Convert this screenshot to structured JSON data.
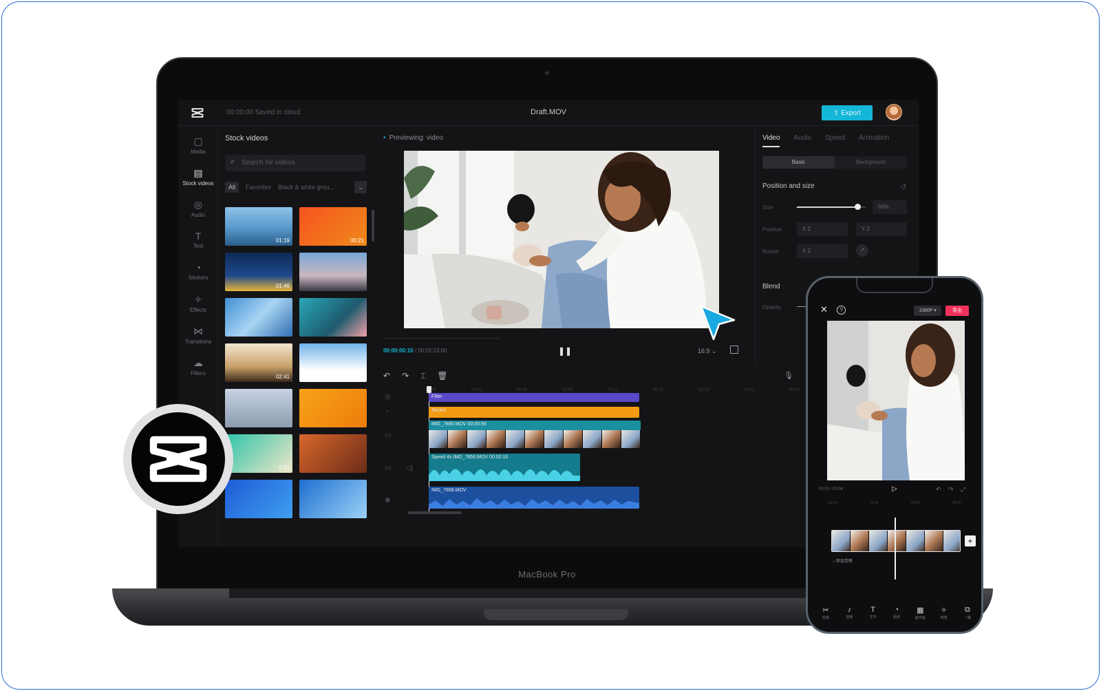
{
  "app": {
    "saved_status": "00:00:00 Saved in cloud",
    "doc_title": "Draft.MOV",
    "export_label": "Export"
  },
  "rail": [
    {
      "label": "Media",
      "icon": "media-icon"
    },
    {
      "label": "Stock videos",
      "icon": "stock-videos-icon",
      "active": true
    },
    {
      "label": "Audio",
      "icon": "audio-icon"
    },
    {
      "label": "Text",
      "icon": "text-icon"
    },
    {
      "label": "Stickers",
      "icon": "stickers-icon"
    },
    {
      "label": "Effects",
      "icon": "effects-icon"
    },
    {
      "label": "Transitions",
      "icon": "transitions-icon"
    },
    {
      "label": "Filters",
      "icon": "filters-icon"
    }
  ],
  "stock": {
    "title": "Stock videos",
    "search_placeholder": "Search for videos",
    "filters": [
      "All",
      "Favorites",
      "Black & white grou..."
    ],
    "durations": [
      "01:19",
      "00:21",
      "01:46",
      "",
      "",
      "",
      "02:41",
      "",
      "",
      "",
      "0:23",
      "",
      "",
      ""
    ]
  },
  "preview": {
    "label": "Previewing: video",
    "timecode_current": "00:00:00:10",
    "timecode_total": "/ 00:02:23:00",
    "ratio": "16:9 ⌄"
  },
  "inspector": {
    "tabs": [
      "Video",
      "Audio",
      "Speed",
      "Animation"
    ],
    "segments": [
      "Basic",
      "Background"
    ],
    "position_section": "Position and size",
    "size_label": "Size",
    "size_value": "60%",
    "size_fraction": 0.6,
    "position_label": "Position",
    "pos_x": "X  2",
    "pos_y": "Y  2",
    "rotate_label": "Rotate",
    "rotate_value": "X  2",
    "blend_section": "Blend",
    "opacity_label": "Opacity"
  },
  "timeline": {
    "ruler": [
      "00:00",
      "00:03",
      "00:06",
      "00:09",
      "00:12",
      "00:15",
      "00:18",
      "00:21",
      "00:24"
    ],
    "filter_clip": "Filter",
    "sticker_clip": "Sticker",
    "main_clip": "IMG_7890.MOV    00:00:56",
    "speed_clip": "Speed 4x    IMG_7856.MOV    00:00:16",
    "audio_clip": "IMG_7898.MOV"
  },
  "laptop_label": "MacBook Pro",
  "phone": {
    "resolution": "1080P ▾",
    "export": "导出",
    "time": "00:00 / 00:08",
    "ruler": [
      "00:00",
      "00:02",
      "00:04",
      "00:06"
    ],
    "audio_label": "♪ 添加音频",
    "tools": [
      {
        "glyph": "✂",
        "label": "剪辑"
      },
      {
        "glyph": "♪",
        "label": "音频"
      },
      {
        "glyph": "T",
        "label": "文字"
      },
      {
        "glyph": "◔",
        "label": "贴纸"
      },
      {
        "glyph": "▦",
        "label": "画中画"
      },
      {
        "glyph": "✧",
        "label": "特效"
      },
      {
        "glyph": "⧉",
        "label": "一键"
      }
    ]
  },
  "colors": {
    "accent": "#14b6d8",
    "filter_track": "#5a49c9",
    "sticker_track": "#f39a12",
    "video_track": "#1a8fa0",
    "audio_track": "#1c4f9e",
    "phone_export": "#f0315a"
  }
}
